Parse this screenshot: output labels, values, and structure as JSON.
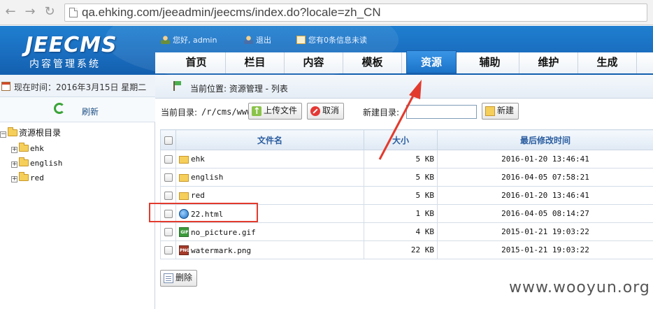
{
  "browser": {
    "back_icon": "back-arrow-icon",
    "forward_icon": "forward-arrow-icon",
    "reload_icon": "reload-icon",
    "url": "qa.ehking.com/jeeadmin/jeecms/index.do?locale=zh_CN"
  },
  "header": {
    "logo": "JEECMS",
    "logo_sub": "内容管理系统",
    "greeting": "您好, admin",
    "logout": "退出",
    "messages": "您有0条信息未读"
  },
  "nav": {
    "tabs": [
      {
        "label": "首页"
      },
      {
        "label": "栏目"
      },
      {
        "label": "内容"
      },
      {
        "label": "模板"
      },
      {
        "label": "资源",
        "active": true
      },
      {
        "label": "辅助"
      },
      {
        "label": "维护"
      },
      {
        "label": "生成"
      }
    ]
  },
  "sidebar": {
    "date_label": "现在时间：",
    "date_value": "2016年3月15日 星期二",
    "refresh": "刷新",
    "tree_root": "资源根目录",
    "tree_items": [
      {
        "label": "ehk"
      },
      {
        "label": "english"
      },
      {
        "label": "red"
      }
    ]
  },
  "main": {
    "location": "当前位置: 资源管理 - 列表",
    "current_dir_label": "当前目录:",
    "current_dir_value": "/r/cms/www",
    "upload_button": "上传文件",
    "cancel_button": "取消",
    "new_dir_label": "新建目录:",
    "new_dir_value": "",
    "new_button": "新建",
    "delete_button": "删除",
    "table": {
      "headers": {
        "name": "文件名",
        "size": "大小",
        "modified": "最后修改时间"
      },
      "rows": [
        {
          "name": "ehk",
          "icon": "folder-icon",
          "size": "5 KB",
          "modified": "2016-01-20 13:46:41"
        },
        {
          "name": "english",
          "icon": "folder-icon",
          "size": "5 KB",
          "modified": "2016-04-05 07:58:21"
        },
        {
          "name": "red",
          "icon": "folder-icon",
          "size": "5 KB",
          "modified": "2016-01-20 13:46:41"
        },
        {
          "name": "22.html",
          "icon": "html-file-icon",
          "size": "1 KB",
          "modified": "2016-04-05 08:14:27"
        },
        {
          "name": "no_picture.gif",
          "icon": "gif-file-icon",
          "icon_tag": "GIF",
          "size": "4 KB",
          "modified": "2015-01-21 19:03:22"
        },
        {
          "name": "watermark.png",
          "icon": "png-file-icon",
          "icon_tag": "PNG",
          "size": "22 KB",
          "modified": "2015-01-21 19:03:22"
        }
      ]
    }
  },
  "annotation": {
    "color": "#e23b2e"
  },
  "watermark": "www.wooyun.org",
  "colors": {
    "header_blue": "#1a6ec0",
    "active_tab": "#2a86d8",
    "table_header_text": "#2a5da0"
  }
}
